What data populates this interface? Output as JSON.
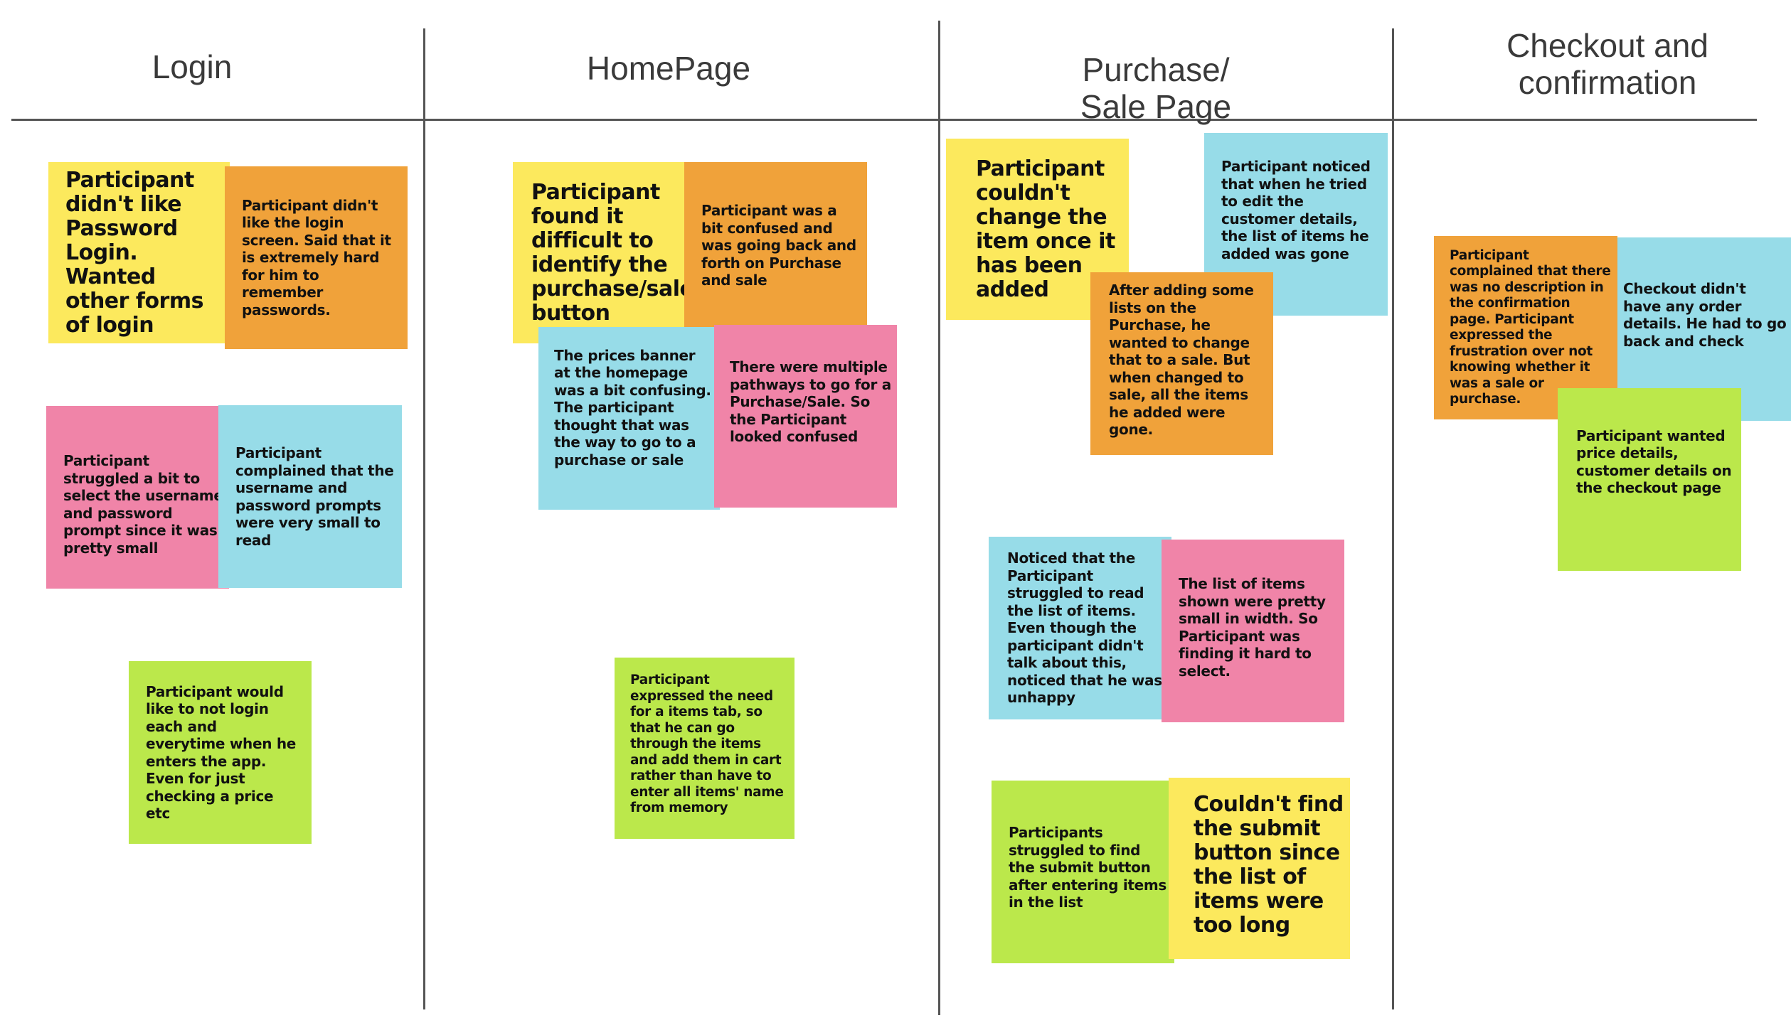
{
  "board": {
    "colors": {
      "yellow": "#fce95d",
      "orange": "#f0a23a",
      "pink": "#f084a8",
      "blue": "#97dce8",
      "green": "#bbe84b",
      "line": "#555555",
      "title": "#3a3a3a"
    },
    "columns": [
      {
        "title": "Login",
        "notes": [
          {
            "color": "yellow",
            "text": "Participant didn't like Password Login. Wanted other forms of login"
          },
          {
            "color": "orange",
            "text": "Participant didn't like the login screen. Said that it is extremely hard for him to remember passwords."
          },
          {
            "color": "pink",
            "text": "Participant struggled a bit to select the username and password prompt since it was pretty small"
          },
          {
            "color": "blue",
            "text": "Participant complained that the username and password prompts were very small to read"
          },
          {
            "color": "green",
            "text": "Participant would like to not login each and everytime when he enters the app. Even for just checking a price etc"
          }
        ]
      },
      {
        "title": "HomePage",
        "notes": [
          {
            "color": "yellow",
            "text": "Participant found it difficult to identify the purchase/sale button"
          },
          {
            "color": "orange",
            "text": "Participant was a bit confused and was going back and forth on Purchase and sale"
          },
          {
            "color": "blue",
            "text": "The prices banner at the homepage was a bit confusing. The participant thought that was the way to go to a purchase or sale"
          },
          {
            "color": "pink",
            "text": "There were multiple pathways to go for a Purchase/Sale. So the Participant looked confused"
          },
          {
            "color": "green",
            "text": "Participant expressed the need for a items tab, so that he can go through the items and add them in cart rather than have to enter all items' name from memory"
          }
        ]
      },
      {
        "title": "Purchase/\nSale Page",
        "notes": [
          {
            "color": "yellow",
            "text": "Participant couldn't change the item once it has been added"
          },
          {
            "color": "blue",
            "text": "Participant noticed that when he tried to edit the customer details, the list of items he added was gone"
          },
          {
            "color": "orange",
            "text": "After adding some lists on the Purchase, he wanted to change that to a sale. But when changed to sale, all the items he added were gone."
          },
          {
            "color": "blue",
            "text": "Noticed that the Participant struggled to read the list of items. Even though the participant didn't talk about this, noticed that he was unhappy"
          },
          {
            "color": "pink",
            "text": "The list of items shown were pretty small in width. So Participant was finding it hard to select."
          },
          {
            "color": "green",
            "text": "Participants struggled to find the submit button after entering items in the list"
          },
          {
            "color": "yellow",
            "text": "Couldn't find the submit button since the list of items were too long"
          }
        ]
      },
      {
        "title": "Checkout and\nconfirmation",
        "notes": [
          {
            "color": "orange",
            "text": "Participant complained that there was no description in the confirmation page. Participant expressed the frustration over not knowing whether it was a sale or purchase."
          },
          {
            "color": "blue",
            "text": "Checkout didn't have any order details. He had to go back and check"
          },
          {
            "color": "green",
            "text": "Participant wanted price details, customer details on the checkout page"
          }
        ]
      }
    ]
  }
}
